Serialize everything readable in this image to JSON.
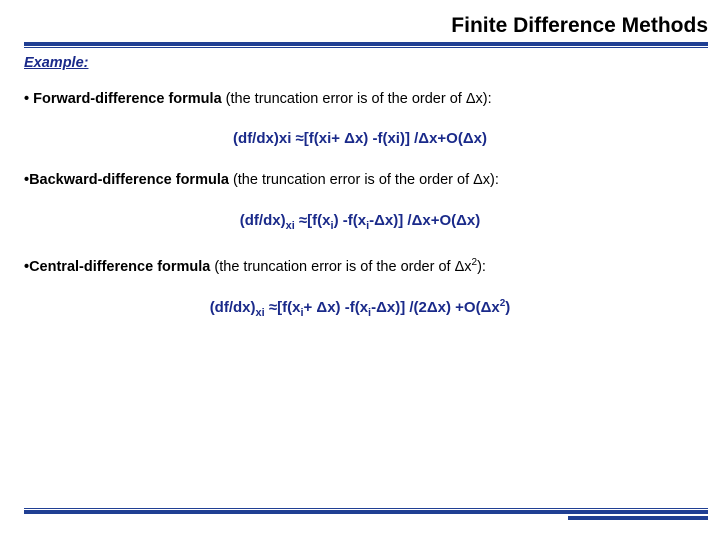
{
  "title": "Finite Difference Methods",
  "example_label": "Example:",
  "sections": {
    "forward": {
      "bullet_bold": "• Forward-difference formula",
      "bullet_rest": " (the truncation error is of the order of Δx):",
      "formula": "(df/dx)xi ≈[f(xi+ Δx) -f(xi)] /Δx+O(Δx)"
    },
    "backward": {
      "bullet_bold": "•Backward-difference formula",
      "bullet_rest": " (the truncation error is of the order of Δx):",
      "formula_pre": "(df/dx)",
      "formula_sub1": "xi",
      "formula_mid1": " ≈[f(x",
      "formula_sub2": "i",
      "formula_mid2": ") -f(x",
      "formula_sub3": "i",
      "formula_mid3": "-Δx)] /Δx+O(Δx)"
    },
    "central": {
      "bullet_bold": "•Central-difference formula",
      "bullet_rest_a": " (the truncation error is of the order of Δx",
      "bullet_sup": "2",
      "bullet_rest_b": "):",
      "formula_pre": "(df/dx)",
      "formula_sub1": "xi",
      "formula_mid1": " ≈[f(x",
      "formula_sub2": "i",
      "formula_mid2": "+ Δx) -f(x",
      "formula_sub3": "i",
      "formula_mid3": "-Δx)] /(2Δx) +O(Δx",
      "formula_sup": "2",
      "formula_end": ")"
    }
  }
}
